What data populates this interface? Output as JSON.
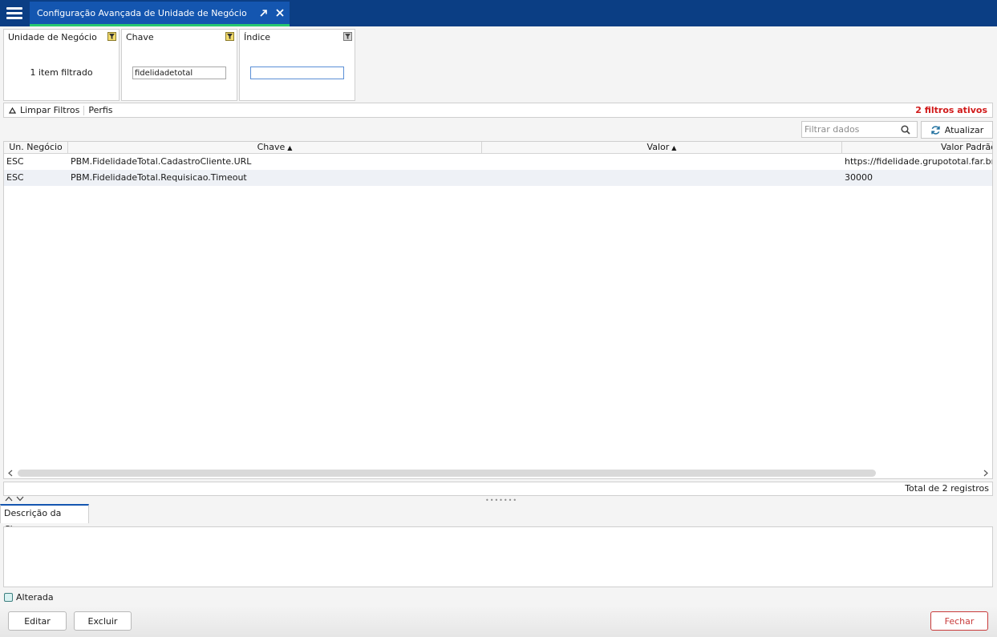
{
  "tab": {
    "title": "Configuração Avançada de Unidade de Negócio"
  },
  "filters": [
    {
      "label": "Unidade de Negócio",
      "summary": "1 item filtrado"
    },
    {
      "label": "Chave",
      "value": "fidelidadetotal"
    },
    {
      "label": "Índice",
      "value": ""
    }
  ],
  "filters_bar": {
    "clear_label": "Limpar Filtros",
    "profiles_label": "Perfis",
    "active_count": "2 filtros ativos"
  },
  "search": {
    "placeholder": "Filtrar dados"
  },
  "refresh": {
    "label": "Atualizar"
  },
  "grid": {
    "columns": [
      {
        "label": "Un. Negócio",
        "sort": ""
      },
      {
        "label": "Chave",
        "sort": "▲"
      },
      {
        "label": "Valor",
        "sort": "▲"
      },
      {
        "label": "Valor Padrão",
        "sort": ""
      }
    ],
    "rows": [
      {
        "unit": "ESC",
        "key": "PBM.FidelidadeTotal.CadastroCliente.URL",
        "value": "",
        "default": "https://fidelidade.grupototal.far.br/"
      },
      {
        "unit": "ESC",
        "key": "PBM.FidelidadeTotal.Requisicao.Timeout",
        "value": "",
        "default": "30000"
      }
    ]
  },
  "total": "Total de 2 registros",
  "details_tab": "Descrição da Chave",
  "altered_label": "Alterada",
  "buttons": {
    "edit": "Editar",
    "delete": "Excluir",
    "close": "Fechar"
  },
  "colors": {
    "header": "#0b3e84",
    "tab_active": "#1456b0",
    "tab_underline": "#28c76f",
    "alert_red": "#d11a1a",
    "close_red": "#c83a3a"
  }
}
